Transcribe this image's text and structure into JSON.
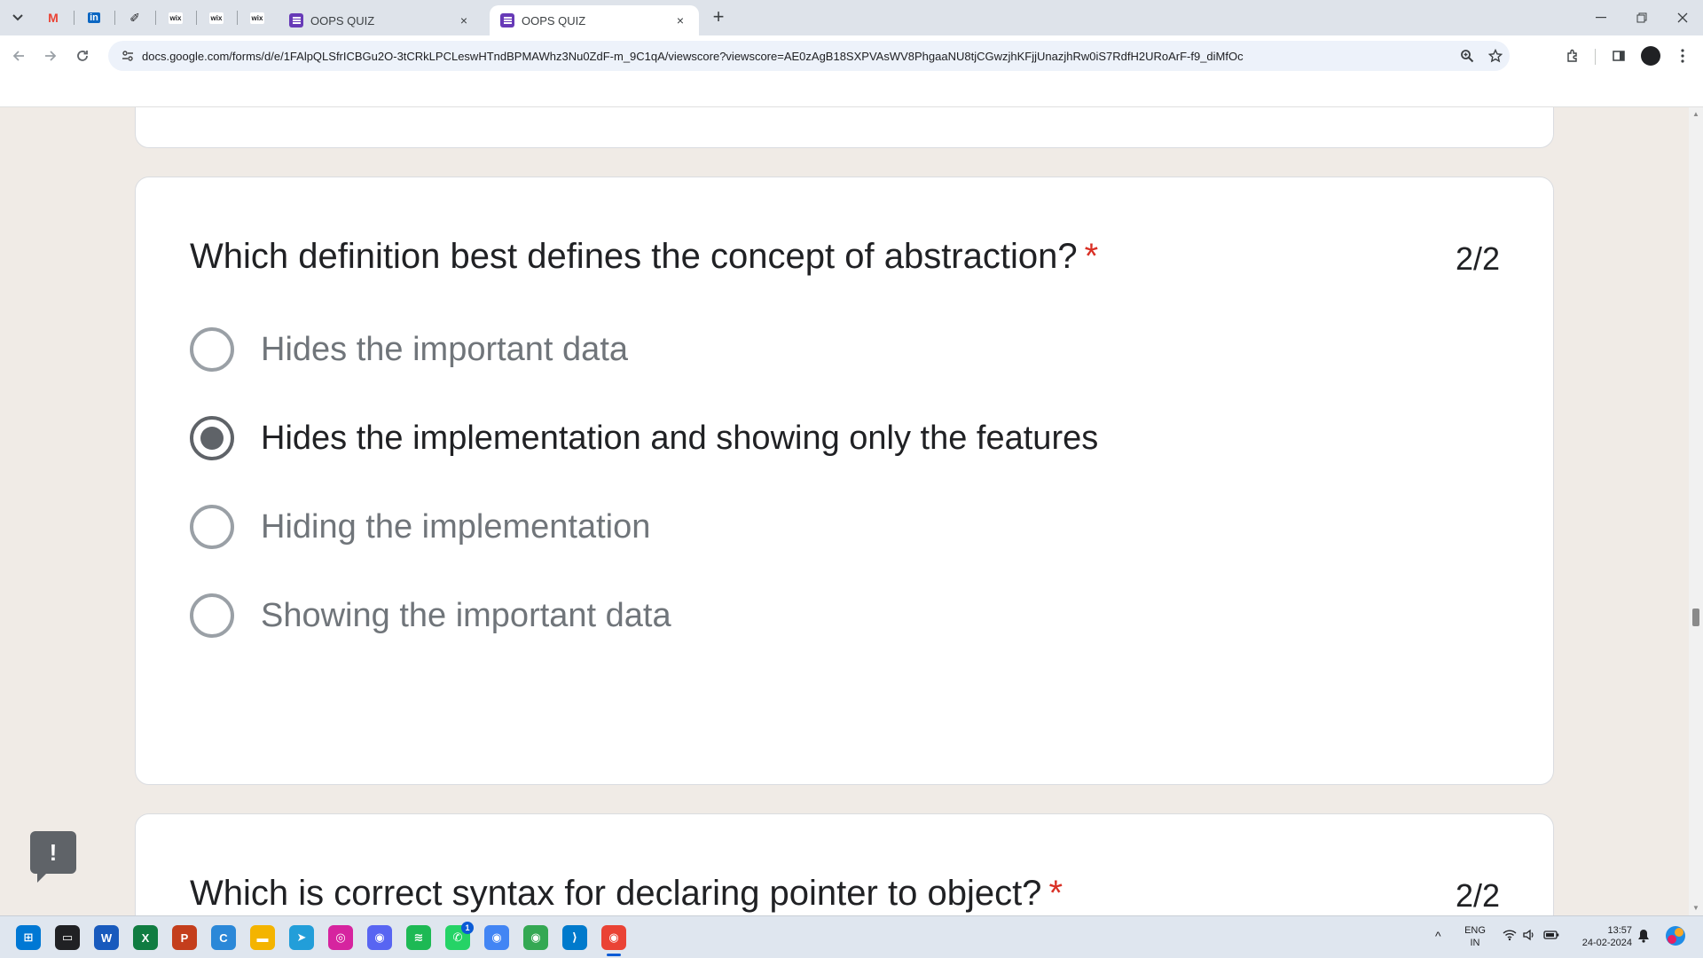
{
  "browser": {
    "tabs": [
      {
        "title": "OOPS QUIZ",
        "close": "×",
        "active": false
      },
      {
        "title": "OOPS QUIZ",
        "close": "×",
        "active": true
      }
    ],
    "pinned_tabs": [
      {
        "icon": "gmail-icon",
        "glyph": "M",
        "color": "#ea4335"
      },
      {
        "icon": "linkedin-icon",
        "glyph": "in",
        "color": "#0a66c2"
      },
      {
        "icon": "feather-icon",
        "glyph": "✐",
        "color": "#202124"
      },
      {
        "icon": "wix-icon",
        "glyph": "wix",
        "color": "#202124"
      },
      {
        "icon": "wix-icon",
        "glyph": "wix",
        "color": "#202124"
      },
      {
        "icon": "wix-icon",
        "glyph": "wix",
        "color": "#202124"
      }
    ],
    "new_tab": "+",
    "url": "docs.google.com/forms/d/e/1FAlpQLSfrICBGu2O-3tCRkLPCLeswHTndBPMAWhz3Nu0ZdF-m_9C1qA/viewscore?viewscore=AE0zAgB18SXPVAsWV8PhgaaNU8tjCGwzjhKFjjUnazjhRw0iS7RdfH2URoArF-f9_diMfOc"
  },
  "form": {
    "questions": [
      {
        "title": "Which definition best defines the concept of abstraction?",
        "required_mark": "*",
        "score": "2/2",
        "options": [
          {
            "label": "Hides the important data",
            "selected": false
          },
          {
            "label": "Hides the implementation and showing only the features",
            "selected": true
          },
          {
            "label": "Hiding the implementation",
            "selected": false
          },
          {
            "label": "Showing the important data",
            "selected": false
          }
        ]
      },
      {
        "title": "Which is correct syntax for declaring pointer to object?",
        "required_mark": "*",
        "score": "2/2"
      }
    ],
    "feedback_button": "!"
  },
  "taskbar": {
    "apps": [
      {
        "name": "start-icon",
        "glyph": "⊞",
        "color": "#0078d4"
      },
      {
        "name": "task-view-icon",
        "glyph": "▭",
        "color": "#202124"
      },
      {
        "name": "word-icon",
        "glyph": "W",
        "color": "#185abd"
      },
      {
        "name": "excel-icon",
        "glyph": "X",
        "color": "#107c41"
      },
      {
        "name": "powerpoint-icon",
        "glyph": "P",
        "color": "#c43e1c"
      },
      {
        "name": "copilot-icon",
        "glyph": "C",
        "color": "#2b88d8"
      },
      {
        "name": "file-explorer-icon",
        "glyph": "▬",
        "color": "#f4b400"
      },
      {
        "name": "telegram-icon",
        "glyph": "➤",
        "color": "#229ed9"
      },
      {
        "name": "instagram-icon",
        "glyph": "◎",
        "color": "#d6249f"
      },
      {
        "name": "discord-icon",
        "glyph": "◉",
        "color": "#5865f2"
      },
      {
        "name": "spotify-icon",
        "glyph": "≋",
        "color": "#1db954"
      },
      {
        "name": "whatsapp-icon",
        "glyph": "✆",
        "color": "#25d366",
        "badge": "1"
      },
      {
        "name": "chrome-icon",
        "glyph": "◉",
        "color": "#4285f4"
      },
      {
        "name": "chrome-profile-icon",
        "glyph": "◉",
        "color": "#34a853"
      },
      {
        "name": "vscode-icon",
        "glyph": "⟩",
        "color": "#007acc"
      },
      {
        "name": "chrome-active-icon",
        "glyph": "◉",
        "color": "#ea4335"
      }
    ],
    "tray": {
      "chevron": "^",
      "lang_line1": "ENG",
      "lang_line2": "IN",
      "time": "13:57",
      "date": "24-02-2024"
    }
  }
}
